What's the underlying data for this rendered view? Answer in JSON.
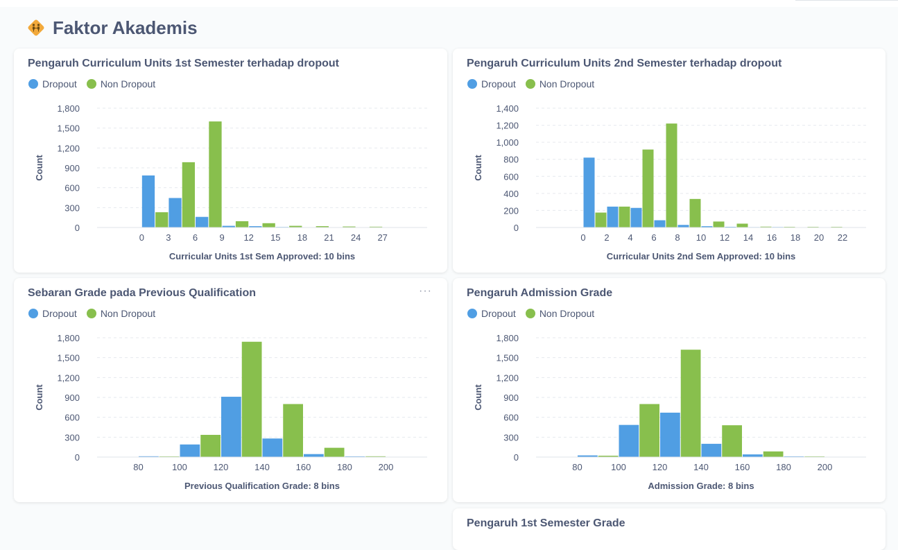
{
  "dashboard": {
    "section_title": "Faktor Akademis"
  },
  "colors": {
    "dropout": "#509ee3",
    "non_dropout": "#88bf4d"
  },
  "legend": {
    "dropout": "Dropout",
    "non_dropout": "Non Dropout"
  },
  "cards": [
    {
      "title": "Pengaruh Curriculum Units 1st Semester terhadap dropout",
      "chart_data": {
        "type": "bar",
        "title": "Pengaruh Curriculum Units 1st Semester terhadap dropout",
        "xlabel": "Curricular Units 1st Sem Approved: 10 bins",
        "ylabel": "Count",
        "xlim": [
          -5,
          32
        ],
        "ylim": [
          0,
          1800
        ],
        "yticks": [
          0,
          300,
          600,
          900,
          1200,
          1500,
          1800
        ],
        "ytick_labels": [
          "0",
          "300",
          "600",
          "900",
          "1,200",
          "1,500",
          "1,800"
        ],
        "xticks": [
          0,
          3,
          6,
          9,
          12,
          15,
          18,
          21,
          24,
          27
        ],
        "xtick_labels": [
          "0",
          "3",
          "6",
          "9",
          "12",
          "15",
          "18",
          "21",
          "24",
          "27"
        ],
        "bin_starts": [
          0,
          3,
          6,
          9,
          12,
          15,
          18,
          21,
          24,
          27
        ],
        "bin_width": 3,
        "series": [
          {
            "name": "Dropout",
            "values": [
              785,
              445,
              160,
              25,
              20,
              8,
              4,
              5,
              3,
              2
            ]
          },
          {
            "name": "Non Dropout",
            "values": [
              230,
              985,
              1600,
              95,
              65,
              25,
              20,
              15,
              12
            ]
          }
        ],
        "legend_position": "top-left",
        "grid": true
      }
    },
    {
      "title": "Pengaruh Curriculum Units 2nd Semester terhadap dropout",
      "chart_data": {
        "type": "bar",
        "title": "Pengaruh Curriculum Units 2nd Semester terhadap dropout",
        "xlabel": "Curricular Units 2nd Sem Approved: 10 bins",
        "ylabel": "Count",
        "xlim": [
          -4,
          24
        ],
        "ylim": [
          0,
          1400
        ],
        "yticks": [
          0,
          200,
          400,
          600,
          800,
          1000,
          1200,
          1400
        ],
        "ytick_labels": [
          "0",
          "200",
          "400",
          "600",
          "800",
          "1,000",
          "1,200",
          "1,400"
        ],
        "xticks": [
          0,
          2,
          4,
          6,
          8,
          10,
          12,
          14,
          16,
          18,
          20,
          22
        ],
        "xtick_labels": [
          "0",
          "2",
          "4",
          "6",
          "8",
          "10",
          "12",
          "14",
          "16",
          "18",
          "20",
          "22"
        ],
        "bin_starts": [
          0,
          2,
          4,
          6,
          8,
          10,
          12,
          14,
          16,
          18,
          20
        ],
        "bin_width": 2,
        "series": [
          {
            "name": "Dropout",
            "values": [
              820,
              245,
              230,
              85,
              30,
              15,
              8,
              5,
              6,
              3,
              2
            ]
          },
          {
            "name": "Non Dropout",
            "values": [
              175,
              245,
              915,
              1220,
              335,
              70,
              45,
              10,
              8,
              8,
              8
            ]
          }
        ],
        "legend_position": "top-left",
        "grid": true
      }
    },
    {
      "title": "Sebaran Grade pada Previous Qualification",
      "chart_data": {
        "type": "bar",
        "title": "Sebaran Grade pada Previous Qualification",
        "xlabel": "Previous Qualification Grade: 8 bins",
        "ylabel": "Count",
        "xlim": [
          60,
          220
        ],
        "ylim": [
          0,
          1800
        ],
        "yticks": [
          0,
          300,
          600,
          900,
          1200,
          1500,
          1800
        ],
        "ytick_labels": [
          "0",
          "300",
          "600",
          "900",
          "1,200",
          "1,500",
          "1,800"
        ],
        "xticks": [
          80,
          100,
          120,
          140,
          160,
          180,
          200
        ],
        "xtick_labels": [
          "80",
          "100",
          "120",
          "140",
          "160",
          "180",
          "200"
        ],
        "bin_starts": [
          80,
          100,
          120,
          140,
          160,
          180,
          200
        ],
        "bin_width": 20,
        "series": [
          {
            "name": "Dropout",
            "values": [
              12,
              190,
              910,
              280,
              45,
              10
            ]
          },
          {
            "name": "Non Dropout",
            "values": [
              10,
              335,
              1740,
              800,
              140,
              12
            ]
          }
        ],
        "legend_position": "top-left",
        "grid": true
      }
    },
    {
      "title": "Pengaruh Admission Grade",
      "chart_data": {
        "type": "bar",
        "title": "Pengaruh Admission Grade",
        "xlabel": "Admission Grade: 8 bins",
        "ylabel": "Count",
        "xlim": [
          60,
          220
        ],
        "ylim": [
          0,
          1800
        ],
        "yticks": [
          0,
          300,
          600,
          900,
          1200,
          1500,
          1800
        ],
        "ytick_labels": [
          "0",
          "300",
          "600",
          "900",
          "1,200",
          "1,500",
          "1,800"
        ],
        "xticks": [
          80,
          100,
          120,
          140,
          160,
          180,
          200
        ],
        "xtick_labels": [
          "80",
          "100",
          "120",
          "140",
          "160",
          "180",
          "200"
        ],
        "bin_starts": [
          80,
          100,
          120,
          140,
          160,
          180,
          200
        ],
        "bin_width": 20,
        "series": [
          {
            "name": "Dropout",
            "values": [
              25,
              485,
              670,
              200,
              40,
              10
            ]
          },
          {
            "name": "Non Dropout",
            "values": [
              20,
              800,
              1620,
              480,
              85,
              10
            ]
          }
        ],
        "legend_position": "top-left",
        "grid": true
      }
    },
    {
      "title": "Pengaruh 1st Semester Grade"
    }
  ]
}
